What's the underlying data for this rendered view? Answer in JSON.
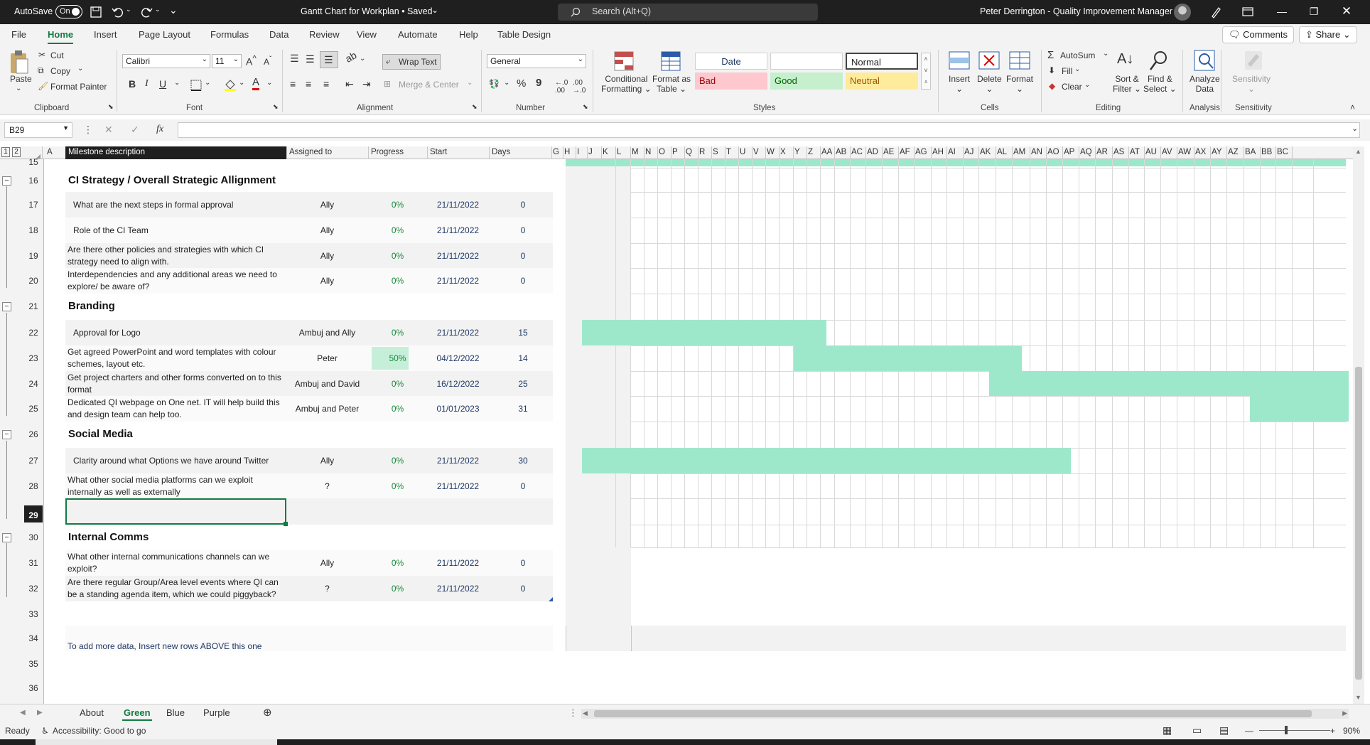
{
  "titlebar": {
    "autosave_label": "AutoSave",
    "autosave_state": "On",
    "doc_title": "Gantt Chart for Workplan • Saved",
    "search_placeholder": "Search (Alt+Q)",
    "user": "Peter Derrington - Quality Improvement Manager"
  },
  "menu": {
    "items": [
      "File",
      "Home",
      "Insert",
      "Page Layout",
      "Formulas",
      "Data",
      "Review",
      "View",
      "Automate",
      "Help",
      "Table Design"
    ],
    "active": "Home",
    "comments": "Comments",
    "share": "Share"
  },
  "ribbon": {
    "clipboard": {
      "paste": "Paste",
      "cut": "Cut",
      "copy": "Copy",
      "format_painter": "Format Painter",
      "group": "Clipboard"
    },
    "font": {
      "name": "Calibri",
      "size": "11",
      "group": "Font"
    },
    "alignment": {
      "wrap_text": "Wrap Text",
      "merge_center": "Merge & Center",
      "group": "Alignment"
    },
    "number": {
      "format": "General",
      "group": "Number"
    },
    "styles": {
      "conditional": "Conditional\nFormatting",
      "format_table": "Format as\nTable",
      "date": "Date",
      "normal": "Normal",
      "bad": "Bad",
      "good": "Good",
      "neutral": "Neutral",
      "group": "Styles"
    },
    "cells": {
      "insert": "Insert",
      "delete": "Delete",
      "format": "Format",
      "group": "Cells"
    },
    "editing": {
      "autosum": "AutoSum",
      "fill": "Fill",
      "clear": "Clear",
      "sort_filter": "Sort &\nFilter",
      "find_select": "Find &\nSelect",
      "group": "Editing"
    },
    "analysis": {
      "analyze": "Analyze\nData",
      "group": "Analysis"
    },
    "sensitivity": {
      "label": "Sensitivity",
      "group": "Sensitivity"
    }
  },
  "formula_bar": {
    "cell_ref": "B29",
    "fx": "fx",
    "value": ""
  },
  "grid": {
    "col_headers": [
      "A",
      "Milestone description",
      "Assigned to",
      "Progress",
      "Start",
      "Days",
      "G",
      "H",
      "I",
      "J",
      "K",
      "L",
      "M",
      "N",
      "O",
      "P",
      "Q",
      "R",
      "S",
      "T",
      "U",
      "V",
      "W",
      "X",
      "Y",
      "Z",
      "AA",
      "AB",
      "AC",
      "AD",
      "AE",
      "AF",
      "AG",
      "AH",
      "AI",
      "AJ",
      "AK",
      "AL",
      "AM",
      "AN",
      "AO",
      "AP",
      "AQ",
      "AR",
      "AS",
      "AT",
      "AU",
      "AV",
      "AW",
      "AX",
      "AY",
      "AZ",
      "BA",
      "BB",
      "BC"
    ],
    "row_numbers": [
      "15",
      "16",
      "17",
      "18",
      "19",
      "20",
      "21",
      "22",
      "23",
      "24",
      "25",
      "26",
      "27",
      "28",
      "29",
      "30",
      "31",
      "32",
      "33",
      "34",
      "35",
      "36"
    ],
    "selected_row": "29",
    "sections": [
      {
        "title": "CI Strategy / Overall Strategic Allignment",
        "rows": [
          {
            "desc": "What are the next steps in formal approval",
            "assigned": "Ally",
            "progress": "0%",
            "start": "21/11/2022",
            "days": "0"
          },
          {
            "desc": "Role of the CI Team",
            "assigned": "Ally",
            "progress": "0%",
            "start": "21/11/2022",
            "days": "0"
          },
          {
            "desc": "Are there other policies and strategies with which CI strategy need to align with.",
            "assigned": "Ally",
            "progress": "0%",
            "start": "21/11/2022",
            "days": "0"
          },
          {
            "desc": "Interdependencies and any additional areas we need to explore/ be aware of?",
            "assigned": "Ally",
            "progress": "0%",
            "start": "21/11/2022",
            "days": "0"
          }
        ]
      },
      {
        "title": "Branding",
        "rows": [
          {
            "desc": "Approval for Logo",
            "assigned": "Ambuj and Ally",
            "progress": "0%",
            "start": "21/11/2022",
            "days": "15"
          },
          {
            "desc": "Get agreed PowerPoint and word templates with colour schemes, layout etc.",
            "assigned": "Peter",
            "progress": "50%",
            "start": "04/12/2022",
            "days": "14"
          },
          {
            "desc": "Get project charters and other forms converted on to this format",
            "assigned": "Ambuj and David",
            "progress": "0%",
            "start": "16/12/2022",
            "days": "25"
          },
          {
            "desc": "Dedicated QI webpage on One net.  IT will help build this and design team can help too.",
            "assigned": "Ambuj and Peter",
            "progress": "0%",
            "start": "01/01/2023",
            "days": "31"
          }
        ]
      },
      {
        "title": "Social Media",
        "rows": [
          {
            "desc": "Clarity around what Options we have around Twitter",
            "assigned": "Ally",
            "progress": "0%",
            "start": "21/11/2022",
            "days": "30"
          },
          {
            "desc": "What other social media platforms can we exploit internally as well as externally",
            "assigned": "?",
            "progress": "0%",
            "start": "21/11/2022",
            "days": "0"
          }
        ]
      },
      {
        "title": "Internal Comms",
        "rows": [
          {
            "desc": "What other internal communications channels can we exploit?",
            "assigned": "Ally",
            "progress": "0%",
            "start": "21/11/2022",
            "days": "0"
          },
          {
            "desc": "Are there regular Group/Area level events where QI can be a standing agenda item, which we could piggyback?",
            "assigned": "?",
            "progress": "0%",
            "start": "21/11/2022",
            "days": "0"
          }
        ]
      }
    ],
    "footer_note": "To add more data, Insert new rows ABOVE this one"
  },
  "sheet_tabs": {
    "tabs": [
      "About",
      "Green",
      "Blue",
      "Purple"
    ],
    "active": "Green"
  },
  "status": {
    "ready": "Ready",
    "accessibility": "Accessibility: Good to go",
    "zoom": "90%"
  },
  "colors": {
    "gantt_bar": "#9de8cb",
    "accent": "#107c41",
    "title_bar": "#1f1f1f"
  }
}
